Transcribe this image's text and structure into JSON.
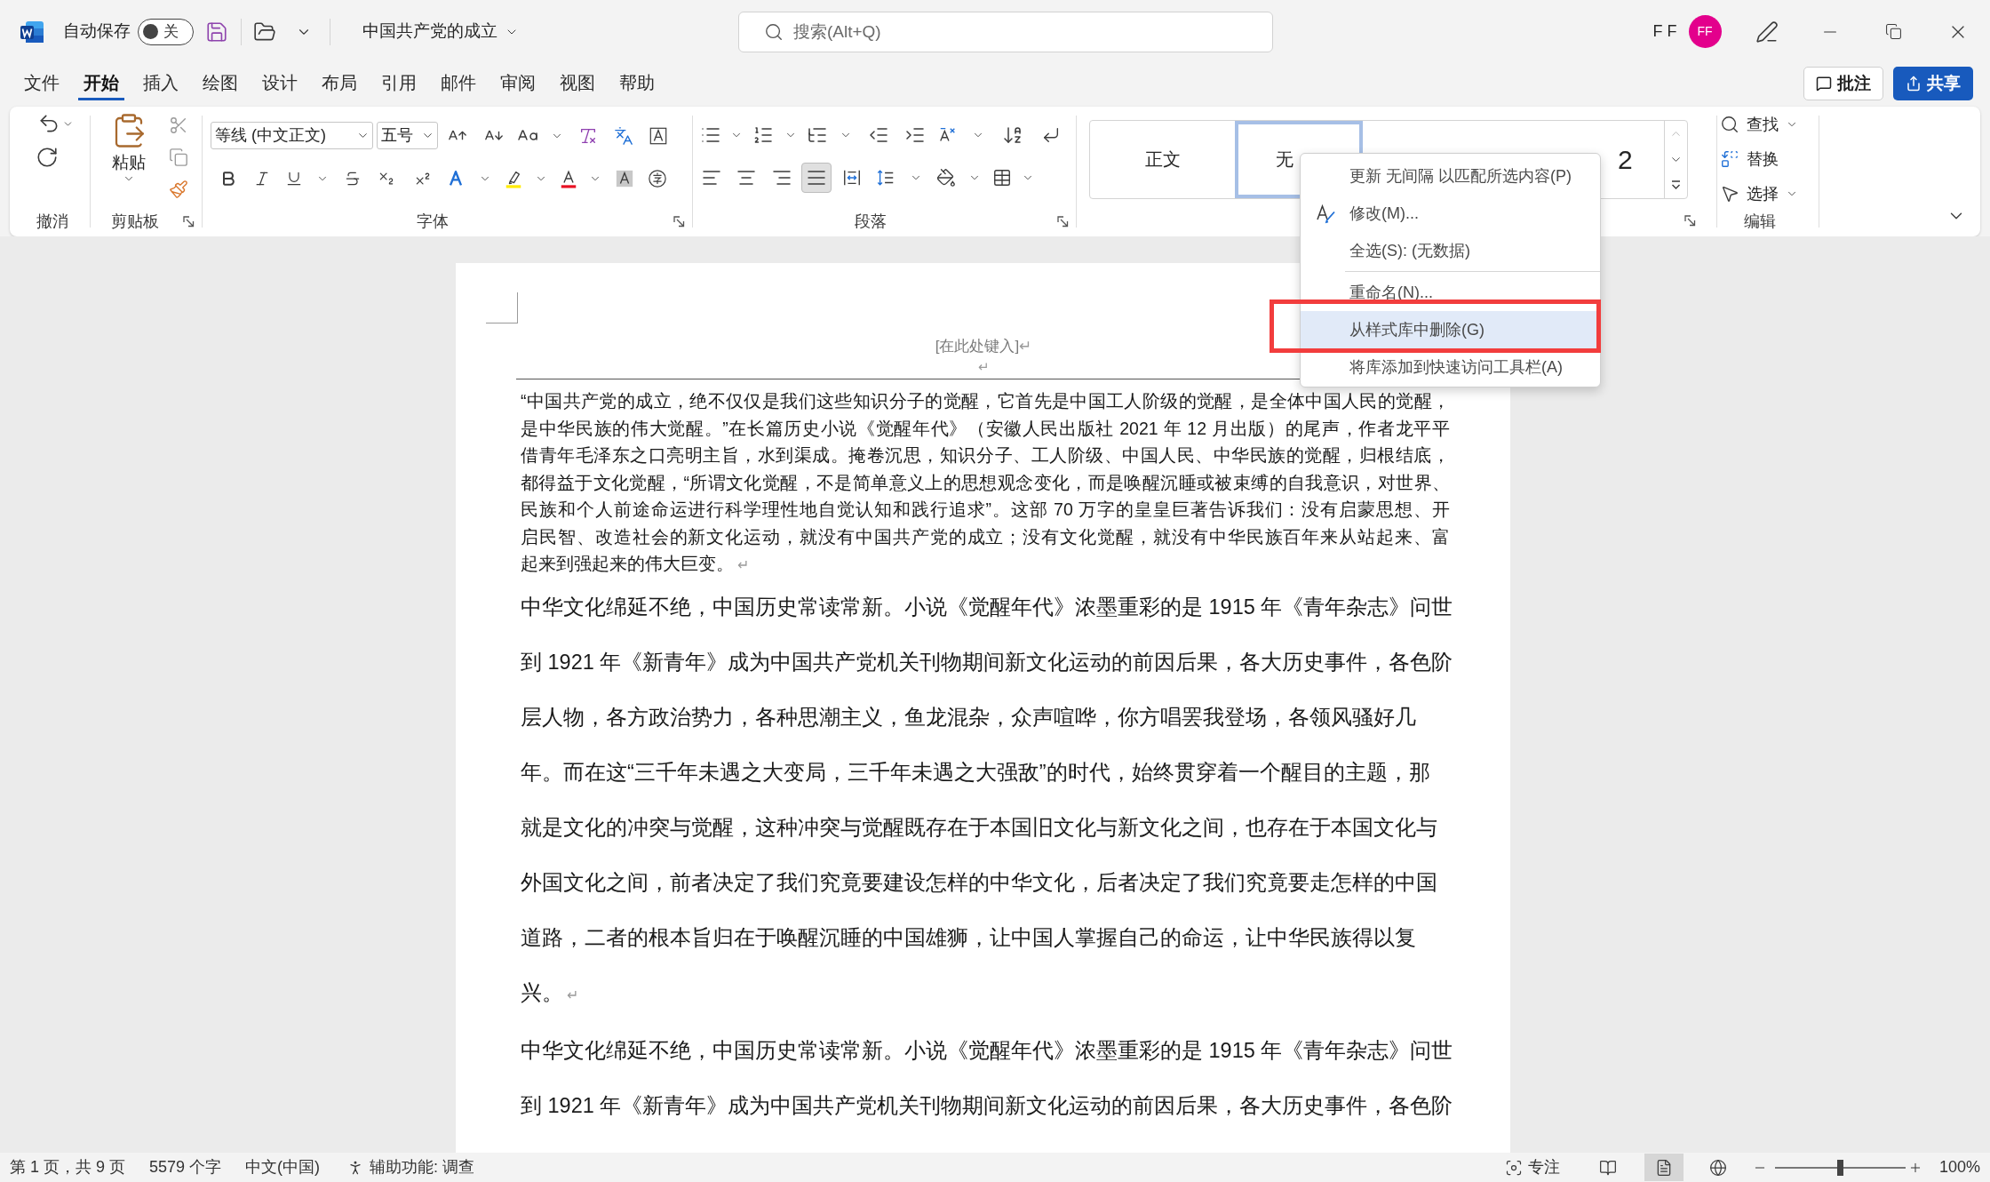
{
  "title_bar": {
    "autosave": {
      "label": "自动保存",
      "on": false,
      "state_label": "关"
    },
    "document_title": "中国共产党的成立",
    "search": {
      "placeholder": "搜索(Alt+Q)"
    },
    "user_name": "F F",
    "avatar": "FF"
  },
  "tabs": [
    {
      "label": "文件",
      "selected": false
    },
    {
      "label": "开始",
      "selected": true
    },
    {
      "label": "插入",
      "selected": false
    },
    {
      "label": "绘图",
      "selected": false
    },
    {
      "label": "设计",
      "selected": false
    },
    {
      "label": "布局",
      "selected": false
    },
    {
      "label": "引用",
      "selected": false
    },
    {
      "label": "邮件",
      "selected": false
    },
    {
      "label": "审阅",
      "selected": false
    },
    {
      "label": "视图",
      "selected": false
    },
    {
      "label": "帮助",
      "selected": false
    }
  ],
  "tab_actions": [
    {
      "label": "批注",
      "kind": "outline"
    },
    {
      "label": "共享",
      "kind": "primary"
    }
  ],
  "ribbon": {
    "undo": {
      "label": "撤消"
    },
    "clipboard": {
      "label": "剪贴板",
      "paste_label": "粘贴"
    },
    "font": {
      "label": "字体",
      "font_name": "等线 (中文正文)",
      "font_size": "五号"
    },
    "paragraph": {
      "label": "段落",
      "alignment": [
        {
          "selected": false
        },
        {
          "selected": false
        },
        {
          "selected": false
        },
        {
          "selected": true
        },
        {
          "selected": false
        }
      ]
    },
    "styles": {
      "items": [
        {
          "label": "正文",
          "kind": "normal",
          "selected": false
        },
        {
          "label": "无",
          "kind": "normal",
          "selected": true
        },
        {
          "label": "2",
          "kind": "heading",
          "selected": false
        }
      ]
    },
    "editing": {
      "label": "编辑",
      "items": [
        {
          "label": "查找",
          "dropdown": true
        },
        {
          "label": "替换",
          "dropdown": false
        },
        {
          "label": "选择",
          "dropdown": true
        }
      ]
    }
  },
  "context_menu": {
    "items": [
      {
        "label": "更新 无间隔 以匹配所选内容(P)",
        "kind": "plain",
        "separator_above": false,
        "selected": false,
        "outlined": false
      },
      {
        "label": "修改(M)...",
        "kind": "icon",
        "separator_above": false,
        "selected": false,
        "outlined": false
      },
      {
        "label": "全选(S): (无数据)",
        "kind": "plain",
        "separator_above": false,
        "selected": false,
        "outlined": false
      },
      {
        "label": "重命名(N)...",
        "kind": "plain",
        "separator_above": true,
        "selected": false,
        "outlined": false
      },
      {
        "label": "从样式库中删除(G)",
        "kind": "plain",
        "separator_above": false,
        "selected": true,
        "outlined": true
      },
      {
        "label": "将库添加到快速访问工具栏(A)",
        "kind": "plain",
        "separator_above": false,
        "selected": false,
        "outlined": false
      }
    ]
  },
  "document": {
    "header": {
      "placeholder": "[在此处键入]",
      "mark": "↵",
      "empty_line_mark": "↵"
    },
    "paragraphs": [
      {
        "kind": "note",
        "mark": "↵",
        "lines": [
          "“中国共产党的成立，绝不仅仅是我们这些知识分子的觉醒，它首先是中国工人阶级的觉醒，是全体中国人民的觉醒，",
          "是中华民族的伟大觉醒。”在长篇历史小说《觉醒年代》（安徽人民出版社 2021 年 12 月出版）的尾声，作者龙平平",
          "借青年毛泽东之口亮明主旨，水到渠成。掩卷沉思，知识分子、工人阶级、中国人民、中华民族的觉醒，归根结底，",
          "都得益于文化觉醒，“所谓文化觉醒，不是简单意义上的思想观念变化，而是唤醒沉睡或被束缚的自我意识，对世界、",
          "民族和个人前途命运进行科学理性地自觉认知和践行追求”。这部 70 万字的皇皇巨著告诉我们：没有启蒙思想、开",
          "启民智、改造社会的新文化运动，就没有中国共产党的成立；没有文化觉醒，就没有中华民族百年来从站起来、富",
          "起来到强起来的伟大巨变。"
        ]
      },
      {
        "kind": "body",
        "mark": "↵",
        "lines": [
          "中华文化绵延不绝，中国历史常读常新。小说《觉醒年代》浓墨重彩的是 1915 年《青年杂志》问世",
          "到 1921 年《新青年》成为中国共产党机关刊物期间新文化运动的前因后果，各大历史事件，各色阶",
          "层人物，各方政治势力，各种思潮主义，鱼龙混杂，众声喧哗，你方唱罢我登场，各领风骚好几",
          "年。而在这“三千年未遇之大变局，三千年未遇之大强敌”的时代，始终贯穿着一个醒目的主题，那",
          "就是文化的冲突与觉醒，这种冲突与觉醒既存在于本国旧文化与新文化之间，也存在于本国文化与",
          "外国文化之间，前者决定了我们究竟要建设怎样的中华文化，后者决定了我们究竟要走怎样的中国",
          "道路，二者的根本旨归在于唤醒沉睡的中国雄狮，让中国人掌握自己的命运，让中华民族得以复",
          "兴。"
        ]
      },
      {
        "kind": "body",
        "lines": [
          "中华文化绵延不绝，中国历史常读常新。小说《觉醒年代》浓墨重彩的是 1915 年《青年杂志》问世",
          "到 1921 年《新青年》成为中国共产党机关刊物期间新文化运动的前因后果，各大历史事件，各色阶"
        ]
      }
    ]
  },
  "status_bar": {
    "page": "第 1 页，共 9 页",
    "words": "5579 个字",
    "language": "中文(中国)",
    "accessibility": "辅助功能: 调查",
    "focus": "专注",
    "views": [
      {
        "selected": false
      },
      {
        "selected": true
      },
      {
        "selected": false
      }
    ],
    "zoom": {
      "level": 0.5,
      "reading": "100%"
    }
  }
}
